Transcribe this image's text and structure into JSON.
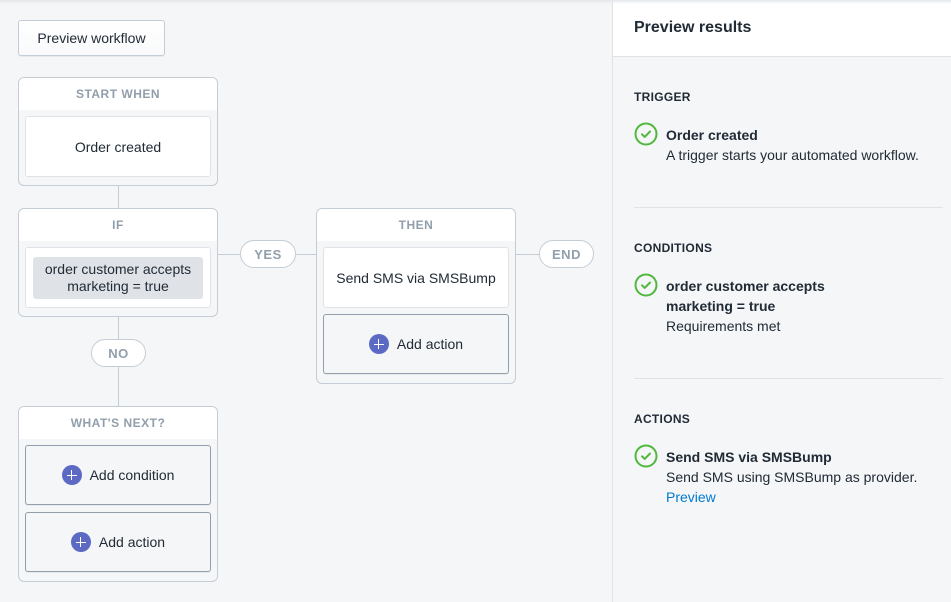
{
  "toolbar": {
    "preview_workflow_label": "Preview workflow"
  },
  "workflow": {
    "start": {
      "header": "START WHEN",
      "trigger": "Order created"
    },
    "if": {
      "header": "IF",
      "condition_line1": "order customer accepts",
      "condition_line2": "marketing = true"
    },
    "branches": {
      "yes": "YES",
      "no": "NO",
      "end": "END"
    },
    "then": {
      "header": "THEN",
      "action": "Send SMS via SMSBump",
      "add_action_label": "Add action"
    },
    "whats_next": {
      "header": "WHAT'S NEXT?",
      "add_condition_label": "Add condition",
      "add_action_label": "Add action"
    }
  },
  "panel": {
    "title": "Preview results",
    "trigger": {
      "section_title": "TRIGGER",
      "title": "Order created",
      "description": "A trigger starts your automated workflow.",
      "status": "success"
    },
    "conditions": {
      "section_title": "CONDITIONS",
      "title_line1": "order customer accepts",
      "title_line2": "marketing = true",
      "description": "Requirements met",
      "status": "success"
    },
    "actions": {
      "section_title": "ACTIONS",
      "title": "Send SMS via SMSBump",
      "description": "Send SMS using SMSBump as provider.",
      "link": "Preview",
      "status": "success"
    }
  },
  "colors": {
    "accent": "#5c6ac4",
    "success": "#50b83c",
    "link": "#007ace",
    "muted_label": "#919eab"
  }
}
